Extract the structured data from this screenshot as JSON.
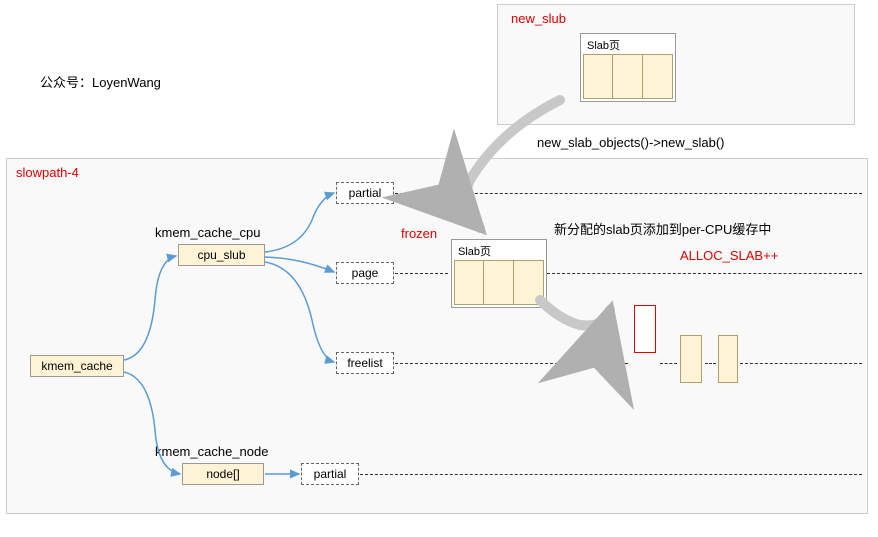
{
  "credit": {
    "prefix": "公众号：",
    "name": "LoyenWang"
  },
  "new_slub": {
    "title": "new_slub",
    "slab_label": "Slab页"
  },
  "func_path": "new_slab_objects()->new_slab()",
  "slowpath": {
    "title": "slowpath-4",
    "kmem_cache": "kmem_cache",
    "cpu": {
      "label": "kmem_cache_cpu",
      "box": "cpu_slub",
      "partial": "partial",
      "page": "page",
      "freelist": "freelist"
    },
    "node": {
      "label": "kmem_cache_node",
      "box": "node[]",
      "partial": "partial"
    },
    "frozen": "frozen",
    "slab_label": "Slab页",
    "note1": "新分配的slab页添加到per-CPU缓存中",
    "note2": "ALLOC_SLAB++"
  }
}
